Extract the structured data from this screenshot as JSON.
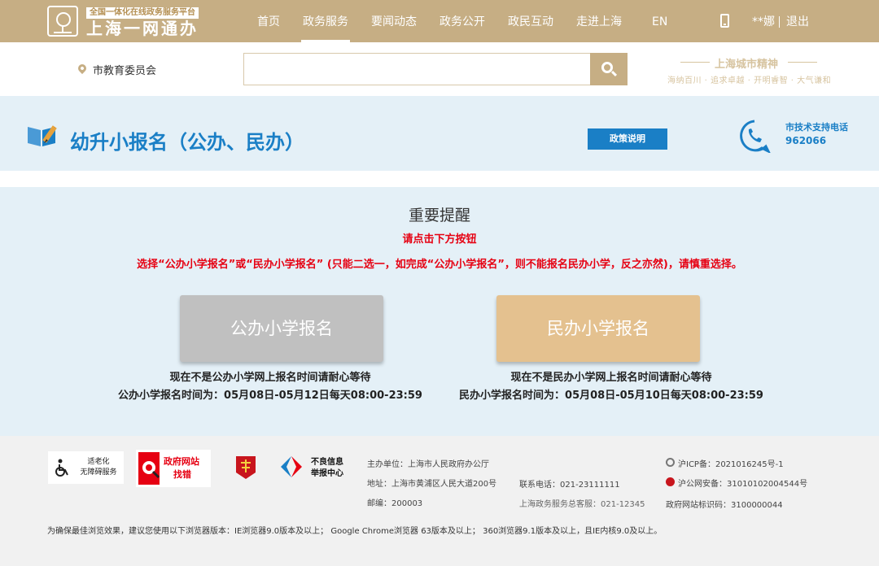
{
  "header": {
    "logo_sub": "全国一体化在线政务服务平台",
    "logo_main": "上海一网通办",
    "nav": [
      "首页",
      "政务服务",
      "要闻动态",
      "政务公开",
      "政民互动",
      "走进上海",
      "EN"
    ],
    "active_nav": "政务服务",
    "user": "**娜",
    "logout": "退出",
    "bar_color": "#c6ae84"
  },
  "search": {
    "location": "市教育委员会",
    "placeholder": "",
    "slogan_title": "上海城市精神",
    "slogan_sub": "海纳百川 · 追求卓越 · 开明睿智 · 大气谦和"
  },
  "service": {
    "title": "幼升小报名（公办、民办）",
    "policy_button": "政策说明",
    "support_label": "市技术支持电话",
    "support_phone": "962066",
    "accent_color": "#1a7fc6"
  },
  "notice": {
    "title": "重要提醒",
    "sub": "请点击下方按钮",
    "line": "选择“公办小学报名”或“民办小学报名” (只能二选一，如完成“公办小学报名”，则不能报名民办小学，反之亦然)，请慎重选择。",
    "public_button": "公办小学报名",
    "private_button": "民办小学报名",
    "public_status": "现在不是公办小学网上报名时间请耐心等待",
    "public_time": "公办小学报名时间为：05月08日-05月12日每天08:00-23:59",
    "private_status": "现在不是民办小学网上报名时间请耐心等待",
    "private_time": "民办小学报名时间为：05月08日-05月10日每天08:00-23:59",
    "warning_color": "#e60012"
  },
  "footer": {
    "accessibility_1": "适老化",
    "accessibility_2": "无障碍服务",
    "gov_site_1": "政府网站",
    "gov_site_2": "找错",
    "report_1": "不良信息",
    "report_2": "举报中心",
    "host": "主办单位：上海市人民政府办公厅",
    "address": "地址：上海市黄浦区人民大道200号",
    "zip": "邮编：200003",
    "contact": "联系电话：021-23111111",
    "hotline": "上海政务服务总客服：021-12345",
    "icp": "沪ICP备：2021016245号-1",
    "police": "沪公网安备：31010102004544号",
    "site_code": "政府网站标识码：3100000044",
    "browser_note": "为确保最佳浏览效果，建议您使用以下浏览器版本：IE浏览器9.0版本及以上；  Google Chrome浏览器 63版本及以上；  360浏览器9.1版本及以上，且IE内核9.0及以上。"
  }
}
